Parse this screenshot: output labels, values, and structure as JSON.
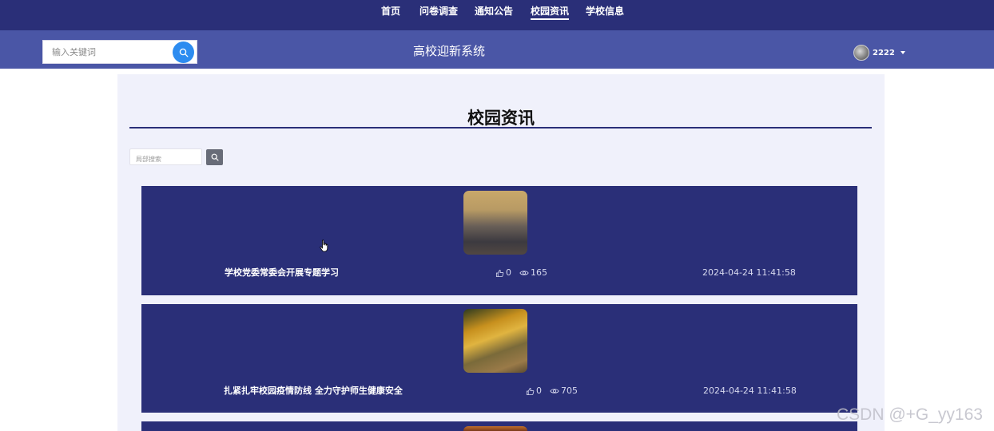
{
  "nav": {
    "items": [
      {
        "label": "首页"
      },
      {
        "label": "问卷调查"
      },
      {
        "label": "通知公告"
      },
      {
        "label": "校园资讯"
      },
      {
        "label": "学校信息"
      }
    ],
    "active": "校园资讯"
  },
  "header": {
    "search_placeholder": "输入关键词",
    "site_title": "高校迎新系统",
    "username": "2222"
  },
  "page": {
    "title": "校园资讯",
    "local_search_placeholder": "局部搜索"
  },
  "news": [
    {
      "title": "学校党委常委会开展专题学习",
      "likes": "0",
      "views": "165",
      "date": "2024-04-24 11:41:58"
    },
    {
      "title": "扎紧扎牢校园疫情防线 全力守护师生健康安全",
      "likes": "0",
      "views": "705",
      "date": "2024-04-24 11:41:58"
    }
  ],
  "watermark": "CSDN @+G_yy163",
  "colors": {
    "nav_bg": "#2a2f78",
    "header_bg": "#4a56a6",
    "card_bg": "#2a2f78",
    "search_btn": "#2d8cf0"
  }
}
